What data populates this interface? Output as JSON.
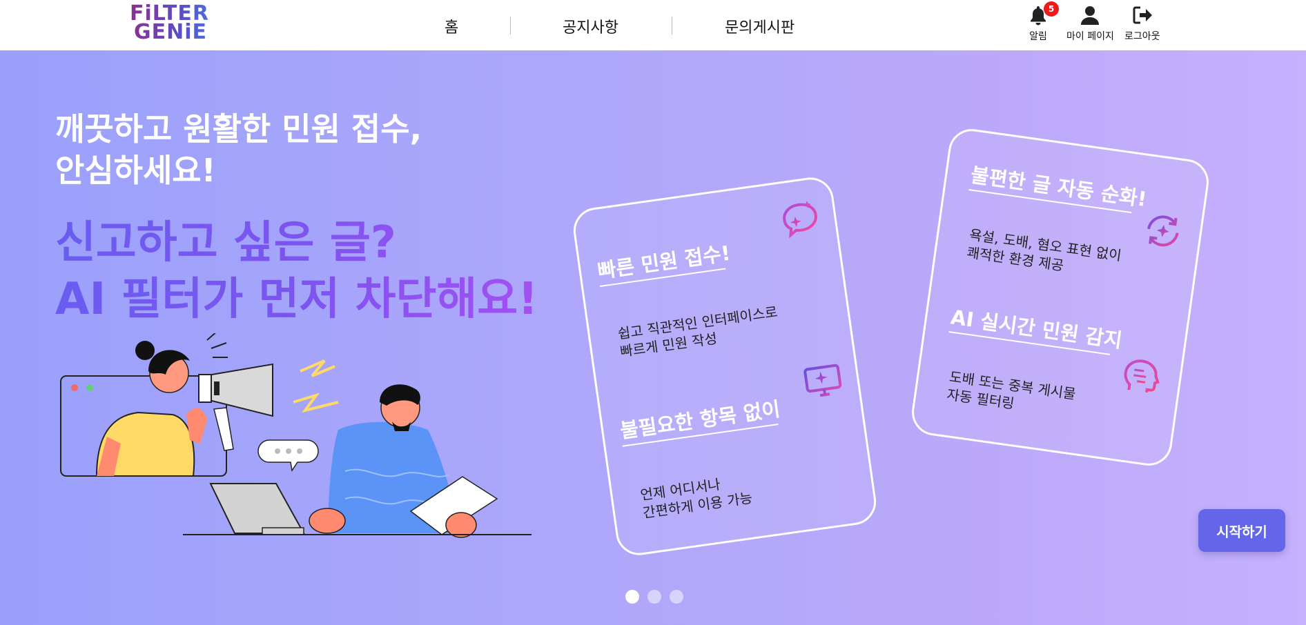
{
  "header": {
    "logo": {
      "line1": "FiLTER",
      "line2": "GENiE"
    },
    "nav": [
      {
        "label": "홈"
      },
      {
        "label": "공지사항"
      },
      {
        "label": "문의게시판"
      }
    ],
    "actions": {
      "notifications": {
        "label": "알림",
        "badge": "5",
        "icon": "bell-icon"
      },
      "mypage": {
        "label": "마이 페이지",
        "icon": "user-icon"
      },
      "logout": {
        "label": "로그아웃",
        "icon": "logout-icon"
      }
    }
  },
  "hero": {
    "headline_line1": "깨끗하고 원활한 민원 접수,",
    "headline_line2": "안심하세요!",
    "highlight_line1": "신고하고 싶은 글?",
    "highlight_line2": "AI 필터가 먼저 차단해요!",
    "cards": [
      {
        "items": [
          {
            "title": "빠른 민원 접수!",
            "desc_line1": "쉽고 직관적인 인터페이스로",
            "desc_line2": "빠르게 민원 작성",
            "icon": "chat-sparkle-icon"
          },
          {
            "title": "불필요한 항목 없이",
            "desc_line1": "언제 어디서나",
            "desc_line2": "간편하게 이용 가능",
            "icon": "monitor-sparkle-icon"
          }
        ]
      },
      {
        "items": [
          {
            "title": "불편한 글 자동 순화!",
            "desc_line1": "욕설, 도배, 혐오 표현 없이",
            "desc_line2": "쾌적한 환경 제공",
            "icon": "refresh-sparkle-icon"
          },
          {
            "title": "AI 실시간 민원 감지",
            "desc_line1": "도배 또는 중복 게시물",
            "desc_line2": "자동 필터링",
            "icon": "ai-head-icon"
          }
        ]
      }
    ],
    "slides": {
      "count": 3,
      "active": 1
    },
    "start_button": "시작하기"
  },
  "colors": {
    "accent": "#6366e8",
    "badge": "#f01818",
    "gradient_start": "#9aa0fb",
    "gradient_end": "#c5b1fc",
    "highlight": "#7c54ef"
  }
}
